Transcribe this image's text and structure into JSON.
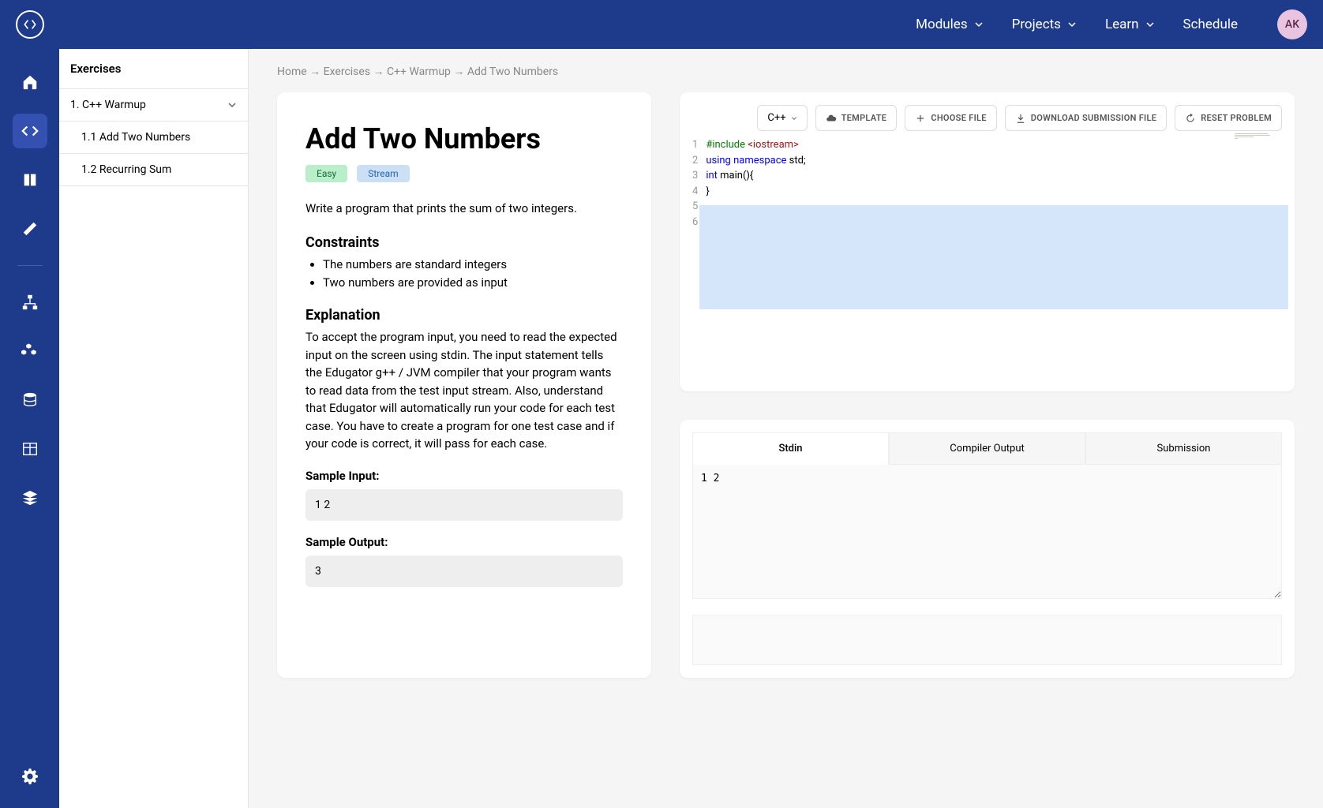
{
  "nav": {
    "modules": "Modules",
    "projects": "Projects",
    "learn": "Learn",
    "schedule": "Schedule"
  },
  "avatar": "AK",
  "exercises": {
    "header": "Exercises",
    "section": "1. C++ Warmup",
    "items": [
      "1.1 Add Two Numbers",
      "1.2 Recurring Sum"
    ]
  },
  "breadcrumb": {
    "home": "Home",
    "exercises": "Exercises",
    "module": "C++ Warmup",
    "current": "Add Two Numbers"
  },
  "problem": {
    "title": "Add Two Numbers",
    "tag_easy": "Easy",
    "tag_stream": "Stream",
    "description": "Write a program that prints the sum of two integers.",
    "constraints_h": "Constraints",
    "constraints": [
      "The numbers are standard integers",
      "Two numbers are provided as input"
    ],
    "explanation_h": "Explanation",
    "explanation": "To accept the program input, you need to read the expected input on the screen using stdin. The input statement tells the Edugator g++ / JVM compiler that your program wants to read data from the test input stream. Also, understand that Edugator will automatically run your code for each test case. You have to create a program for one test case and if your code is correct, it will pass for each case.",
    "sample_input_label": "Sample Input:",
    "sample_input": "1 2",
    "sample_output_label": "Sample Output:",
    "sample_output": "3"
  },
  "editor": {
    "lang": "C++",
    "template_btn": "TEMPLATE",
    "choose_file_btn": "CHOOSE FILE",
    "download_btn": "DOWNLOAD SUBMISSION FILE",
    "reset_btn": "RESET PROBLEM",
    "lines": {
      "l1a": "#include",
      "l1b": " <iostream>",
      "l2a": "using",
      "l2b": " namespace",
      "l2c": " std;",
      "l3a": "int",
      "l3b": " main(){",
      "l4": "",
      "l5": "}"
    }
  },
  "io": {
    "tabs": [
      "Stdin",
      "Compiler Output",
      "Submission"
    ],
    "stdin_value": "1 2"
  }
}
